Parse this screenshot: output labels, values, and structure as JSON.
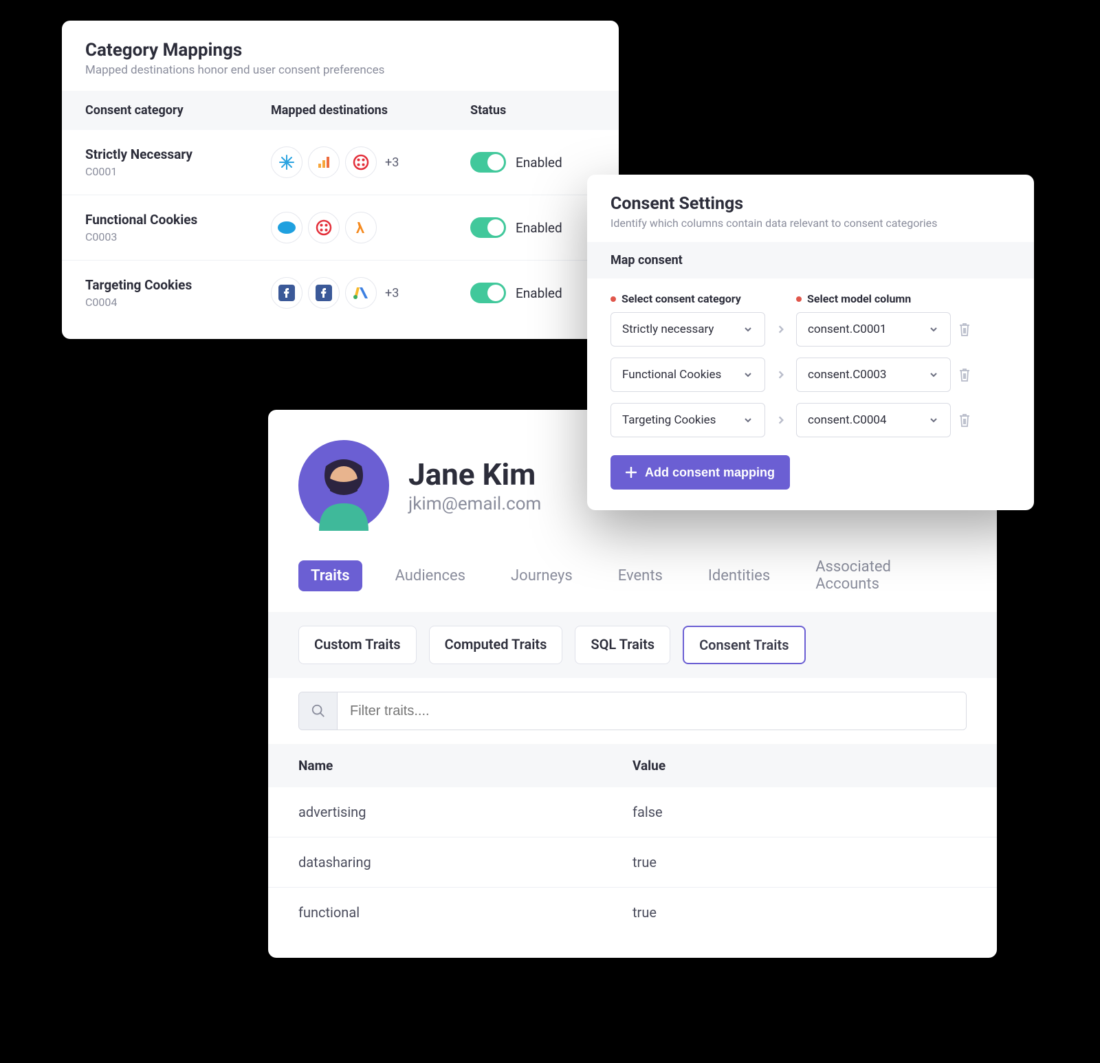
{
  "mappings": {
    "title": "Category Mappings",
    "subtitle": "Mapped destinations honor end user consent preferences",
    "columns": {
      "category": "Consent category",
      "dest": "Mapped destinations",
      "status": "Status"
    },
    "status_label": "Enabled",
    "rows": [
      {
        "name": "Strictly Necessary",
        "id": "C0001",
        "icons": [
          "snowflake",
          "analytics",
          "twilio"
        ],
        "more": "+3"
      },
      {
        "name": "Functional Cookies",
        "id": "C0003",
        "icons": [
          "salesforce",
          "twilio",
          "lambda"
        ],
        "more": ""
      },
      {
        "name": "Targeting Cookies",
        "id": "C0004",
        "icons": [
          "facebook",
          "facebook",
          "google-ads"
        ],
        "more": "+3"
      }
    ]
  },
  "consent": {
    "title": "Consent Settings",
    "subtitle": "Identify which columns contain data relevant to consent categories",
    "section": "Map consent",
    "label_category": "Select consent category",
    "label_column": "Select model column",
    "rows": [
      {
        "category": "Strictly necessary",
        "column": "consent.C0001"
      },
      {
        "category": "Functional Cookies",
        "column": "consent.C0003"
      },
      {
        "category": "Targeting Cookies",
        "column": "consent.C0004"
      }
    ],
    "add_button": "Add consent mapping"
  },
  "profile": {
    "name": "Jane Kim",
    "email": "jkim@email.com",
    "tabs": [
      "Traits",
      "Audiences",
      "Journeys",
      "Events",
      "Identities",
      "Associated Accounts"
    ],
    "active_tab": 0,
    "trait_filters": [
      "Custom Traits",
      "Computed Traits",
      "SQL Traits",
      "Consent Traits"
    ],
    "selected_filter": 3,
    "search_placeholder": "Filter traits....",
    "trait_columns": {
      "name": "Name",
      "value": "Value"
    },
    "traits": [
      {
        "name": "advertising",
        "value": "false"
      },
      {
        "name": "datasharing",
        "value": "true"
      },
      {
        "name": "functional",
        "value": "true"
      }
    ]
  }
}
